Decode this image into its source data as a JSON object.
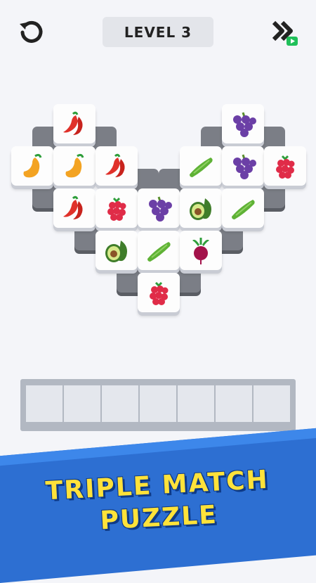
{
  "header": {
    "level_label": "LEVEL 3",
    "restart_icon": "restart-icon",
    "skip_icon": "skip-level-icon",
    "skip_badge_color": "#20c05a"
  },
  "board": {
    "tiles": [
      {
        "fruit": "chili"
      },
      {
        "fruit": "grapes"
      },
      {
        "fruit": "mango"
      },
      {
        "fruit": "mango"
      },
      {
        "fruit": "chili"
      },
      {
        "fruit": "cucumber"
      },
      {
        "fruit": "grapes"
      },
      {
        "fruit": "raspberry"
      },
      {
        "fruit": "chili"
      },
      {
        "fruit": "raspberry"
      },
      {
        "fruit": "grapes"
      },
      {
        "fruit": "avocado"
      },
      {
        "fruit": "cucumber"
      },
      {
        "fruit": "avocado"
      },
      {
        "fruit": "cucumber"
      },
      {
        "fruit": "beet"
      },
      {
        "fruit": "raspberry"
      }
    ]
  },
  "tray": {
    "slot_count": 7
  },
  "banner": {
    "line1": "TRIPLE MATCH",
    "line2": "PUZZLE",
    "bg_color": "#2d6fd2",
    "text_color": "#ffe23a"
  }
}
